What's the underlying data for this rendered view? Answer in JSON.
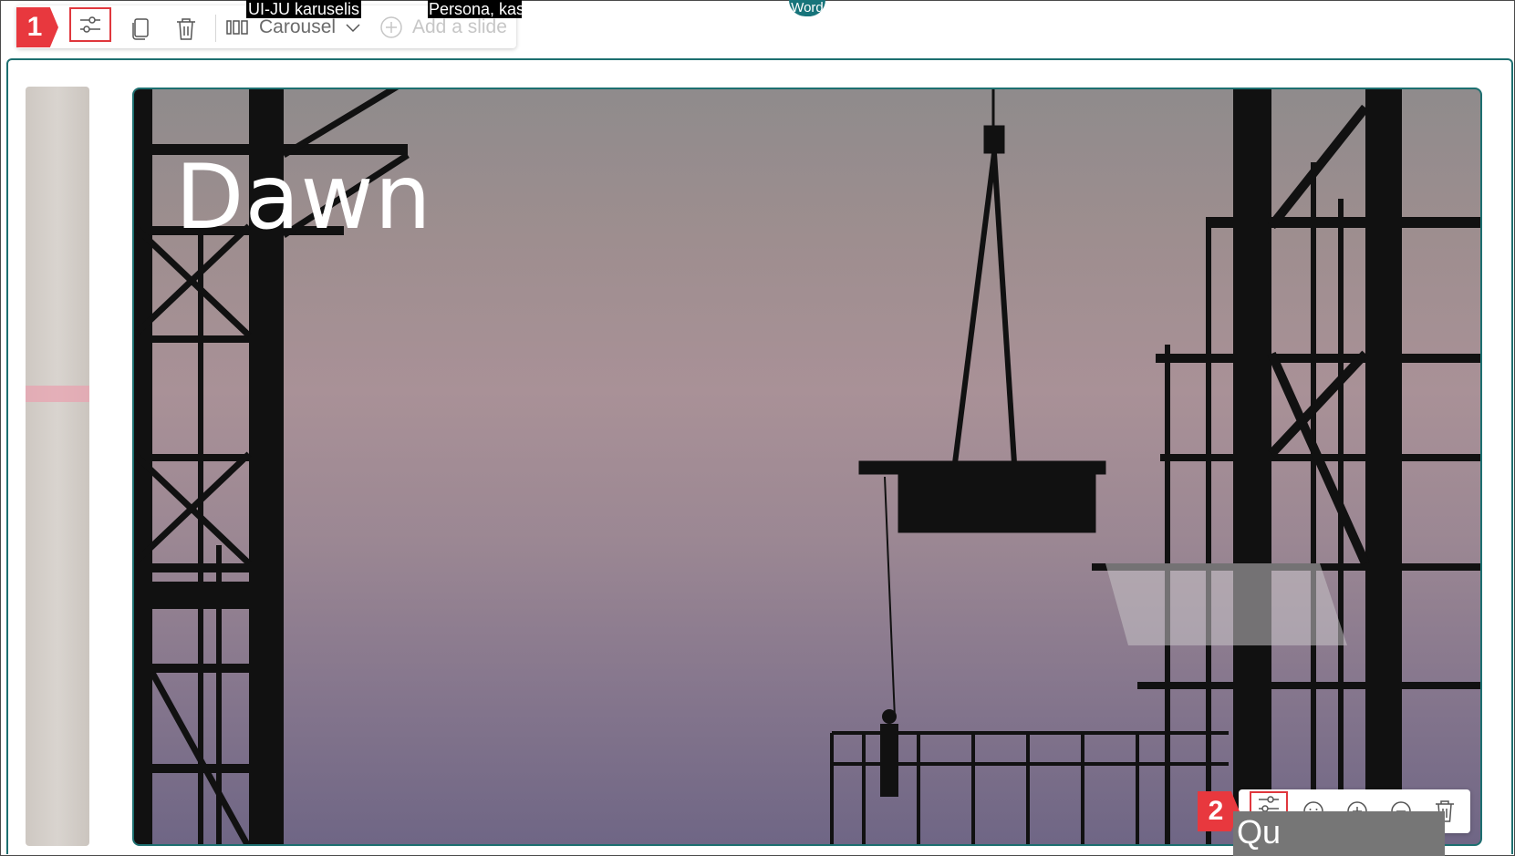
{
  "labels": {
    "tag_1": "UI-JU karuselis",
    "tag_2": "Persona, kas",
    "tag_3": "Word"
  },
  "badges": {
    "one": "1",
    "two": "2"
  },
  "toolbar": {
    "layout_label": "Carousel",
    "add_slide_label": "Add a slide",
    "icons": [
      "settings-sliders-icon",
      "duplicate-icon",
      "delete-icon",
      "carousel-layout-icon",
      "chevron-down-icon",
      "add-circle-icon"
    ]
  },
  "slide": {
    "title": "Dawn"
  },
  "image_toolbar": {
    "icons": [
      "settings-sliders-icon",
      "smiley-icon",
      "zoom-in-icon",
      "zoom-out-icon",
      "delete-icon"
    ]
  },
  "tooltip": {
    "text": "Qu"
  },
  "colors": {
    "accent": "#1d6f70",
    "callout": "#e8383e"
  }
}
